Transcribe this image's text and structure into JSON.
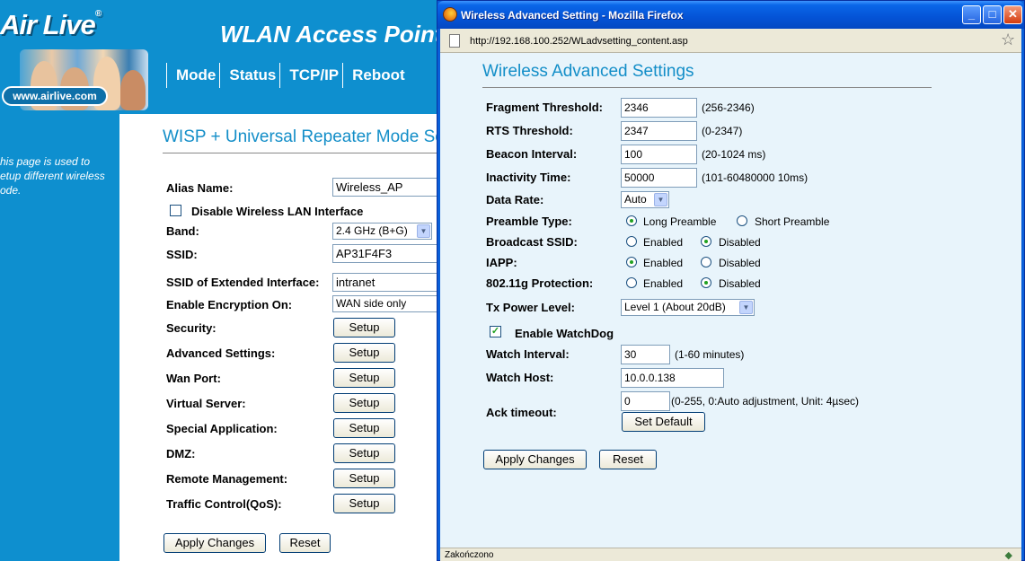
{
  "background_page": {
    "logo_text": "Air Live",
    "logo_trademark": "®",
    "logo_url": "www.airlive.com",
    "header_title": "WLAN Access Point",
    "nav": [
      "Mode",
      "Status",
      "TCP/IP",
      "Reboot"
    ],
    "sidebar_text": [
      "his page is used to",
      "etup different wireless",
      "ode."
    ],
    "page_title": "WISP + Universal Repeater Mode Settings",
    "alias_label": "Alias Name:",
    "alias_value": "Wireless_AP",
    "disable_wlan_label": "Disable Wireless LAN Interface",
    "band_label": "Band:",
    "band_value": "2.4 GHz (B+G)",
    "ssid_label": "SSID:",
    "ssid_value": "AP31F4F3",
    "ssid_ext_label": "SSID of Extended Interface:",
    "ssid_ext_value": "intranet",
    "encryption_label": "Enable Encryption On:",
    "encryption_value": "WAN side only",
    "setup_rows": [
      {
        "label": "Security:",
        "button": "Setup"
      },
      {
        "label": "Advanced Settings:",
        "button": "Setup"
      },
      {
        "label": "Wan Port:",
        "button": "Setup"
      },
      {
        "label": "Virtual Server:",
        "button": "Setup"
      },
      {
        "label": "Special Application:",
        "button": "Setup"
      },
      {
        "label": "DMZ:",
        "button": "Setup"
      },
      {
        "label": "Remote Management:",
        "button": "Setup"
      },
      {
        "label": "Traffic Control(QoS):",
        "button": "Setup"
      }
    ],
    "apply_button": "Apply Changes",
    "reset_button": "Reset",
    "colors": {
      "header_blue": "#0e8fcf",
      "title_blue": "#138ec8"
    }
  },
  "firefox_window": {
    "title": "Wireless Advanced Setting - Mozilla Firefox",
    "url": "http://192.168.100.252/WLadvsetting_content.asp",
    "status": "Zakończono",
    "window_buttons": [
      "_",
      "□",
      "✕"
    ],
    "page_title": "Wireless Advanced Settings",
    "fields": {
      "fragment": {
        "label": "Fragment Threshold:",
        "value": "2346",
        "hint": "(256-2346)"
      },
      "rts": {
        "label": "RTS Threshold:",
        "value": "2347",
        "hint": "(0-2347)"
      },
      "beacon": {
        "label": "Beacon Interval:",
        "value": "100",
        "hint": "(20-1024 ms)"
      },
      "inactivity": {
        "label": "Inactivity Time:",
        "value": "50000",
        "hint": "(101-60480000 10ms)"
      },
      "data_rate": {
        "label": "Data Rate:",
        "value": "Auto"
      },
      "preamble": {
        "label": "Preamble Type:",
        "option1": "Long Preamble",
        "option2": "Short Preamble",
        "selected": "Long Preamble"
      },
      "broadcast_ssid": {
        "label": "Broadcast SSID:",
        "option1": "Enabled",
        "option2": "Disabled",
        "selected": "Disabled"
      },
      "iapp": {
        "label": "IAPP:",
        "option1": "Enabled",
        "option2": "Disabled",
        "selected": "Enabled"
      },
      "protection": {
        "label": "802.11g Protection:",
        "option1": "Enabled",
        "option2": "Disabled",
        "selected": "Disabled"
      },
      "tx_power": {
        "label": "Tx Power Level:",
        "value": "Level 1 (About 20dB)"
      },
      "watchdog": {
        "label": "Enable WatchDog",
        "checked": true
      },
      "watch_interval": {
        "label": "Watch Interval:",
        "value": "30",
        "hint": "(1-60 minutes)"
      },
      "watch_host": {
        "label": "Watch Host:",
        "value": "10.0.0.138"
      },
      "ack_timeout": {
        "label": "Ack timeout:",
        "value": "0",
        "hint": "(0-255, 0:Auto adjustment, Unit: 4µsec)",
        "button": "Set Default"
      }
    },
    "apply_button": "Apply Changes",
    "reset_button": "Reset"
  }
}
